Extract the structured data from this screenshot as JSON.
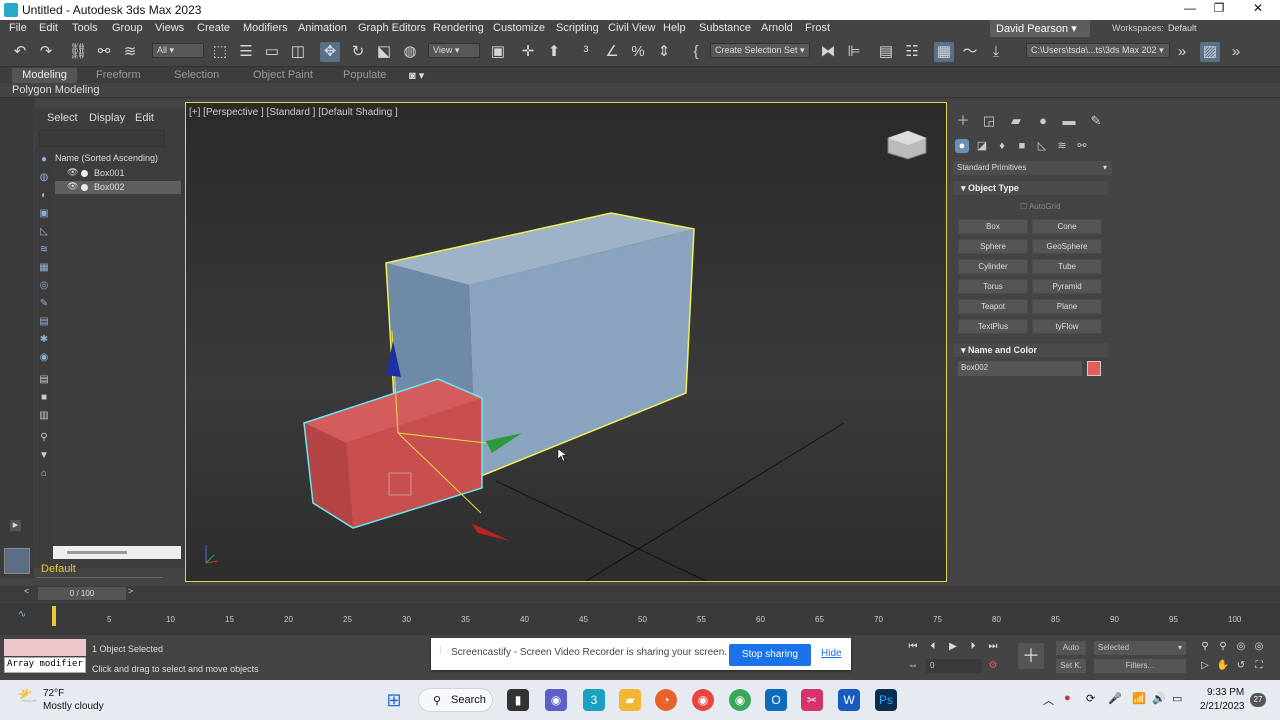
{
  "window": {
    "title": "Untitled - Autodesk 3ds Max 2023",
    "minimize": "—",
    "restore": "❐",
    "close": "✕"
  },
  "menu": [
    "File",
    "Edit",
    "Tools",
    "Group",
    "Views",
    "Create",
    "Modifiers",
    "Animation",
    "Graph Editors",
    "Rendering",
    "Customize",
    "Scripting",
    "Civil View",
    "Help",
    "Substance",
    "Arnold",
    "Frost"
  ],
  "user": "David Pearson",
  "workspaces": {
    "label": "Workspaces:",
    "value": "Default"
  },
  "toolbar": {
    "selection_filter": "All",
    "ref_coord": "View",
    "named_selection": "Create Selection Set",
    "path": "C:\\Users\\tsda\\...ts\\3ds Max 202"
  },
  "ribbon": {
    "tabs": [
      "Modeling",
      "Freeform",
      "Selection",
      "Object Paint",
      "Populate"
    ],
    "active_tab": "Modeling",
    "panel": "Polygon Modeling"
  },
  "scene_explorer": {
    "tabs": [
      "Select",
      "Display",
      "Edit"
    ],
    "column_header": "Name (Sorted Ascending)",
    "items": [
      {
        "name": "Box001",
        "selected": false
      },
      {
        "name": "Box002",
        "selected": true
      }
    ],
    "layer": "Default"
  },
  "viewport": {
    "label": "[+] [Perspective ] [Standard ] [Default Shading ]"
  },
  "command_panel": {
    "category": "Standard Primitives",
    "object_type_title": "Object Type",
    "autogrid": "AutoGrid",
    "buttons": [
      "Box",
      "Cone",
      "Sphere",
      "GeoSphere",
      "Cylinder",
      "Tube",
      "Torus",
      "Pyramid",
      "Teapot",
      "Plane",
      "TextPlus",
      "tyFlow"
    ],
    "name_color_title": "Name and Color",
    "object_name": "Box002",
    "object_color": "#e25d5d"
  },
  "timeline": {
    "current": "0 / 100",
    "ticks": [
      "0",
      "5",
      "10",
      "15",
      "20",
      "25",
      "30",
      "35",
      "40",
      "45",
      "50",
      "55",
      "60",
      "65",
      "70",
      "75",
      "80",
      "85",
      "90",
      "95",
      "100"
    ]
  },
  "status": {
    "maxscript": "Array modifier",
    "selected": "1 Object Selected",
    "prompt": "Click and drag to select and move objects",
    "auto_key": "Auto",
    "set_key": "Set K.",
    "key_filter": "Selected",
    "filters": "Filters...",
    "frame": "0"
  },
  "share_notice": {
    "text": "Screencastify - Screen Video Recorder is sharing your screen.",
    "stop": "Stop sharing",
    "hide": "Hide"
  },
  "taskbar": {
    "weather_temp": "72°F",
    "weather_desc": "Mostly cloudy",
    "search": "Search",
    "time": "9:33 PM",
    "date": "2/21/2023",
    "badge": "27"
  }
}
